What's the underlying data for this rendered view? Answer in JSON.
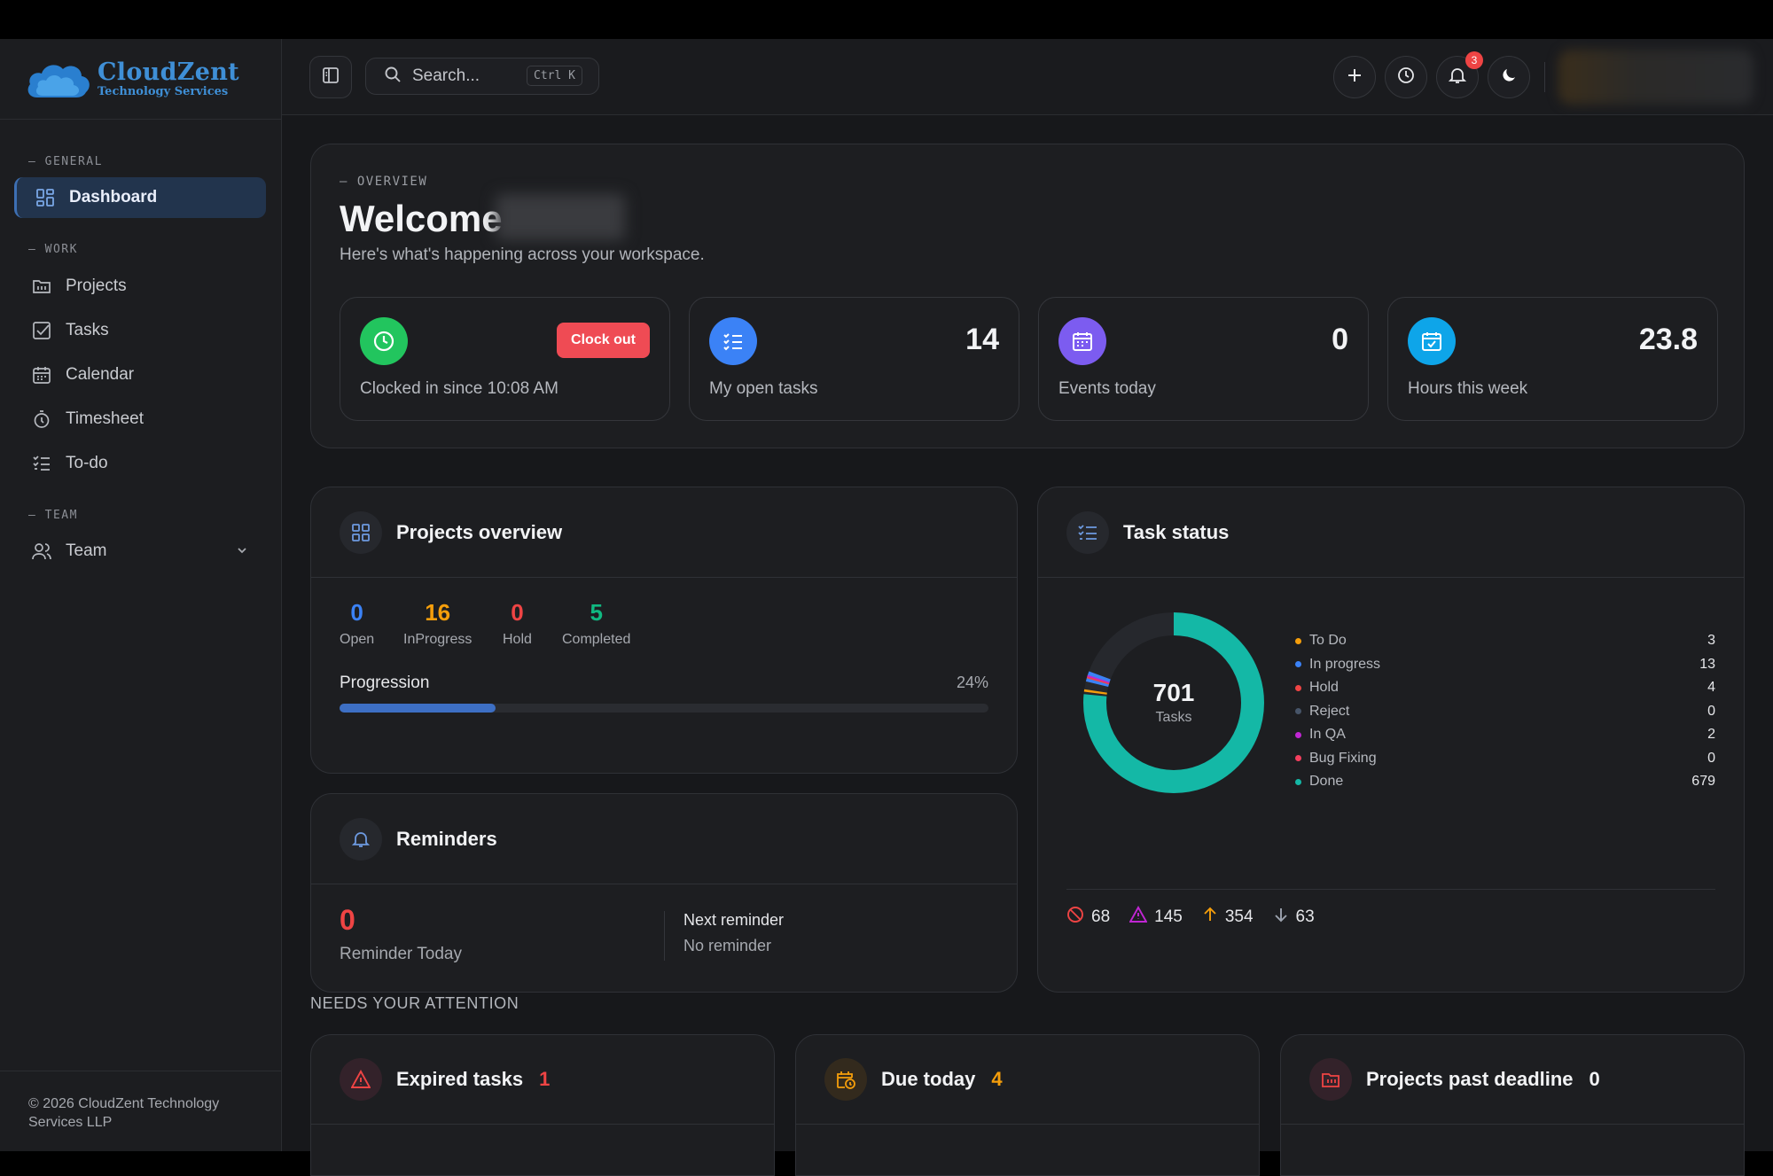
{
  "brand": {
    "name": "CloudZent",
    "subtitle": "Technology Services",
    "accent": "#3f8fd6"
  },
  "sidebar": {
    "sections": [
      "— GENERAL",
      "— WORK",
      "— TEAM"
    ],
    "items": [
      {
        "label": "Dashboard",
        "icon": "grid-icon",
        "active": true
      },
      {
        "label": "Projects",
        "icon": "folder-icon"
      },
      {
        "label": "Tasks",
        "icon": "checkbox-icon"
      },
      {
        "label": "Calendar",
        "icon": "calendar-icon"
      },
      {
        "label": "Timesheet",
        "icon": "stopwatch-icon"
      },
      {
        "label": "To-do",
        "icon": "list-check-icon"
      },
      {
        "label": "Team",
        "icon": "users-icon"
      }
    ],
    "footer": "© 2026 CloudZent Technology Services LLP"
  },
  "header": {
    "search_placeholder": "Search...",
    "shortcut": "Ctrl K",
    "notification_count": "3"
  },
  "overview": {
    "label": "— OVERVIEW",
    "welcome": "Welcome",
    "subtitle": "Here's what's happening across your workspace.",
    "stats": [
      {
        "label": "Clocked in since 10:08 AM",
        "action": "Clock out",
        "icon": "clock-icon",
        "color": "#22c55e"
      },
      {
        "label": "My open tasks",
        "value": "14",
        "icon": "list-check-icon",
        "color": "#3b82f6"
      },
      {
        "label": "Events today",
        "value": "0",
        "icon": "calendar-icon",
        "color": "#7c5cf0"
      },
      {
        "label": "Hours this week",
        "value": "23.8",
        "icon": "calendar-check-icon",
        "color": "#0ea5e9"
      }
    ]
  },
  "projects": {
    "title": "Projects overview",
    "stats": [
      {
        "value": "0",
        "label": "Open",
        "color": "#3b82f6"
      },
      {
        "value": "16",
        "label": "InProgress",
        "color": "#f59e0b"
      },
      {
        "value": "0",
        "label": "Hold",
        "color": "#ef4444"
      },
      {
        "value": "5",
        "label": "Completed",
        "color": "#10b981"
      }
    ],
    "progression_label": "Progression",
    "progression_pct": "24%",
    "progression_value": 0.24
  },
  "reminders": {
    "title": "Reminders",
    "today_value": "0",
    "today_label": "Reminder Today",
    "next_label": "Next reminder",
    "next_value": "No reminder"
  },
  "task_status": {
    "title": "Task status",
    "total": "701",
    "total_label": "Tasks",
    "legend": [
      {
        "label": "To Do",
        "value": "3",
        "color": "#f59e0b"
      },
      {
        "label": "In progress",
        "value": "13",
        "color": "#3b82f6"
      },
      {
        "label": "Hold",
        "value": "4",
        "color": "#ef4444"
      },
      {
        "label": "Reject",
        "value": "0",
        "color": "#475569"
      },
      {
        "label": "In QA",
        "value": "2",
        "color": "#c026d3"
      },
      {
        "label": "Bug Fixing",
        "value": "0",
        "color": "#f43f5e"
      },
      {
        "label": "Done",
        "value": "679",
        "color": "#14b8a6"
      }
    ],
    "footer": [
      {
        "value": "68",
        "icon": "ban-icon",
        "color": "#ef4444"
      },
      {
        "value": "145",
        "icon": "warning-icon",
        "color": "#c026d3"
      },
      {
        "value": "354",
        "icon": "arrow-up-icon",
        "color": "#f59e0b"
      },
      {
        "value": "63",
        "icon": "arrow-down-icon",
        "color": "#9ca3af"
      }
    ]
  },
  "attention": {
    "title": "NEEDS YOUR ATTENTION",
    "cards": [
      {
        "title": "Expired tasks",
        "count": "1",
        "count_color": "#ef4444",
        "icon": "warning-icon"
      },
      {
        "title": "Due today",
        "count": "4",
        "count_color": "#f59e0b",
        "icon": "calendar-clock-icon"
      },
      {
        "title": "Projects past deadline",
        "count": "0",
        "count_color": "#f2f3f5",
        "icon": "folder-alert-icon"
      }
    ]
  }
}
